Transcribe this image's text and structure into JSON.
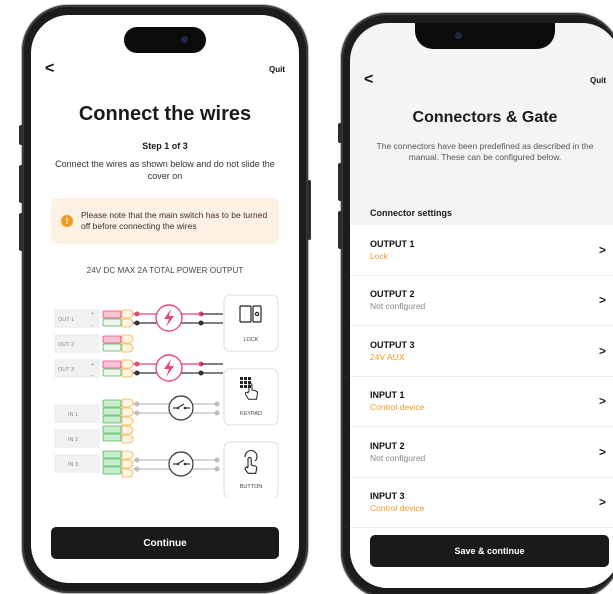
{
  "left": {
    "back": "<",
    "quit": "Quit",
    "title": "Connect the wires",
    "step": "Step 1 of 3",
    "description": "Connect the wires as shown below and do not slide the cover on",
    "note": "Please note that the main switch has to be turned off before connecting the wires",
    "note_icon": "!",
    "power_label": "24V DC MAX 2A TOTAL POWER OUTPUT",
    "terminals": [
      "OUT 1",
      "OUT 2",
      "OUT 3",
      "IN 1",
      "IN 2",
      "IN 3"
    ],
    "plus": "+",
    "minus": "−",
    "devices": [
      "LOCK",
      "KEYPAD",
      "BUTTON"
    ],
    "continue": "Continue"
  },
  "right": {
    "back": "<",
    "quit": "Quit",
    "title": "Connectors & Gate",
    "description": "The connectors have been predefined as described in the manual. These can be configured below.",
    "section": "Connector settings",
    "rows": [
      {
        "title": "OUTPUT 1",
        "value": "Lock",
        "style": "orange"
      },
      {
        "title": "OUTPUT 2",
        "value": "Not configured",
        "style": "gray"
      },
      {
        "title": "OUTPUT 3",
        "value": "24V AUX",
        "style": "orange"
      },
      {
        "title": "INPUT 1",
        "value": "Control device",
        "style": "orange"
      },
      {
        "title": "INPUT 2",
        "value": "Not configured",
        "style": "gray"
      },
      {
        "title": "INPUT 3",
        "value": "Control device",
        "style": "orange"
      }
    ],
    "chevron": ">",
    "save": "Save & continue"
  },
  "colors": {
    "accent": "#f29a1f",
    "dark_button": "#1a1a1a",
    "note_bg": "#fdf1e3",
    "out_pink": "#e8457a",
    "in_green": "#4cb85c"
  }
}
